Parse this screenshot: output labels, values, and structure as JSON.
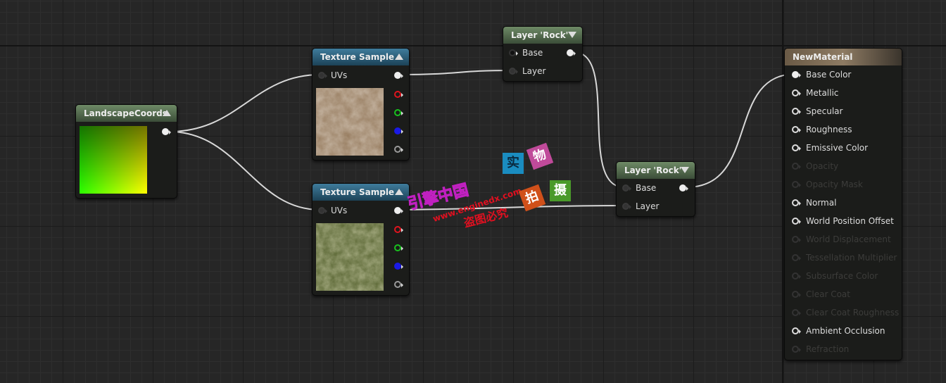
{
  "nodes": {
    "landscape_coords": {
      "title": "LandscapeCoords",
      "color": "#5a7352"
    },
    "texture_sample_1": {
      "title": "Texture Sample",
      "input": "UVs",
      "preview": "rock-dirt-texture"
    },
    "texture_sample_2": {
      "title": "Texture Sample",
      "input": "UVs",
      "preview": "grass-texture"
    },
    "layer_rock_1": {
      "title": "Layer 'Rock'",
      "inputs": [
        "Base",
        "Layer"
      ]
    },
    "layer_rock_2": {
      "title": "Layer 'Rock'",
      "inputs": [
        "Base",
        "Layer"
      ]
    },
    "new_material": {
      "title": "NewMaterial",
      "inputs": [
        {
          "label": "Base Color",
          "enabled": true,
          "connected": true
        },
        {
          "label": "Metallic",
          "enabled": true
        },
        {
          "label": "Specular",
          "enabled": true
        },
        {
          "label": "Roughness",
          "enabled": true
        },
        {
          "label": "Emissive Color",
          "enabled": true
        },
        {
          "label": "Opacity",
          "enabled": false
        },
        {
          "label": "Opacity Mask",
          "enabled": false
        },
        {
          "label": "Normal",
          "enabled": true
        },
        {
          "label": "World Position Offset",
          "enabled": true
        },
        {
          "label": "World Displacement",
          "enabled": false
        },
        {
          "label": "Tessellation Multiplier",
          "enabled": false
        },
        {
          "label": "Subsurface Color",
          "enabled": false
        },
        {
          "label": "Clear Coat",
          "enabled": false
        },
        {
          "label": "Clear Coat Roughness",
          "enabled": false
        },
        {
          "label": "Ambient Occlusion",
          "enabled": true
        },
        {
          "label": "Refraction",
          "enabled": false
        }
      ]
    }
  },
  "pin_colors": {
    "rgba": "#ffffff",
    "r": "#e0141e",
    "g": "#18c21e",
    "b": "#1a1ae6",
    "a": "#9a9a9a"
  },
  "watermark": {
    "site_name": "引擎中国",
    "url": "www.enginedx.com",
    "notice": "盗图必究",
    "tiles": [
      "实",
      "物",
      "拍",
      "摄"
    ]
  }
}
